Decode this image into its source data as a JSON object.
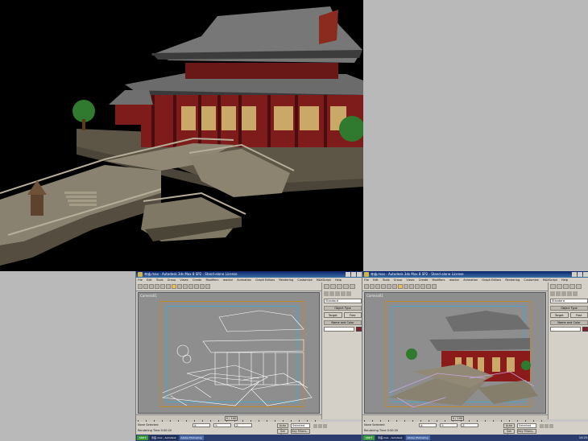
{
  "windows": [
    {
      "title": "寺庙.max - Autodesk 3ds Max 8 SP2 - Stand-alone License",
      "menu": [
        "File",
        "Edit",
        "Tools",
        "Group",
        "Views",
        "Create",
        "Modifiers",
        "reactor",
        "Animation",
        "Graph Editors",
        "Rendering",
        "Customize",
        "MAXScript",
        "Help"
      ],
      "viewport_label": "Camera01",
      "view_dropdown": "View",
      "category_dropdown": "Standard",
      "rollout_object_type": "Object Type",
      "btn_target": "Target",
      "btn_free": "Free",
      "rollout_name_color": "Name and Color",
      "time_slider": "0 / 100",
      "status_line1": "None Selected",
      "status_line2": "Rendering Time 0:00:20",
      "x_field": "X:",
      "y_field": "Y:",
      "z_field": "Z:",
      "autokey": "Auto Key",
      "selected": "Selected",
      "setkey": "Set Key",
      "keyfilters": "Key Filters...",
      "display_mode": "wireframe"
    },
    {
      "title": "寺庙.max - Autodesk 3ds Max 8 SP2 - Stand-alone License",
      "menu": [
        "File",
        "Edit",
        "Tools",
        "Group",
        "Views",
        "Create",
        "Modifiers",
        "reactor",
        "Animation",
        "Graph Editors",
        "Rendering",
        "Customize",
        "MAXScript",
        "Help"
      ],
      "viewport_label": "Camera01",
      "view_dropdown": "View",
      "category_dropdown": "Standard",
      "rollout_object_type": "Object Type",
      "btn_target": "Target",
      "btn_free": "Free",
      "rollout_name_color": "Name and Color",
      "time_slider": "0 / 100",
      "status_line1": "None Selected",
      "status_line2": "Rendering Time 0:00:20",
      "x_field": "X:",
      "y_field": "Y:",
      "z_field": "Z:",
      "autokey": "Auto Key",
      "selected": "Selected",
      "setkey": "Set Key",
      "keyfilters": "Key Filters...",
      "display_mode": "shaded"
    }
  ],
  "taskbar": {
    "start": "start",
    "tasks": [
      "寺庙.max - Autodesk",
      "Adobe Photoshop"
    ],
    "clock": "14:20"
  },
  "colors": {
    "render_background": "#000000",
    "wireframe": "#ffffff",
    "roof": "#6e6e6e",
    "walls": "#8b1a1a",
    "stone": "#8a8270",
    "tree": "#2f7a2f",
    "viewport_bg": "#8e8e8e",
    "title_bar": "#0a246a"
  },
  "render": {
    "subject": "temple-render"
  }
}
